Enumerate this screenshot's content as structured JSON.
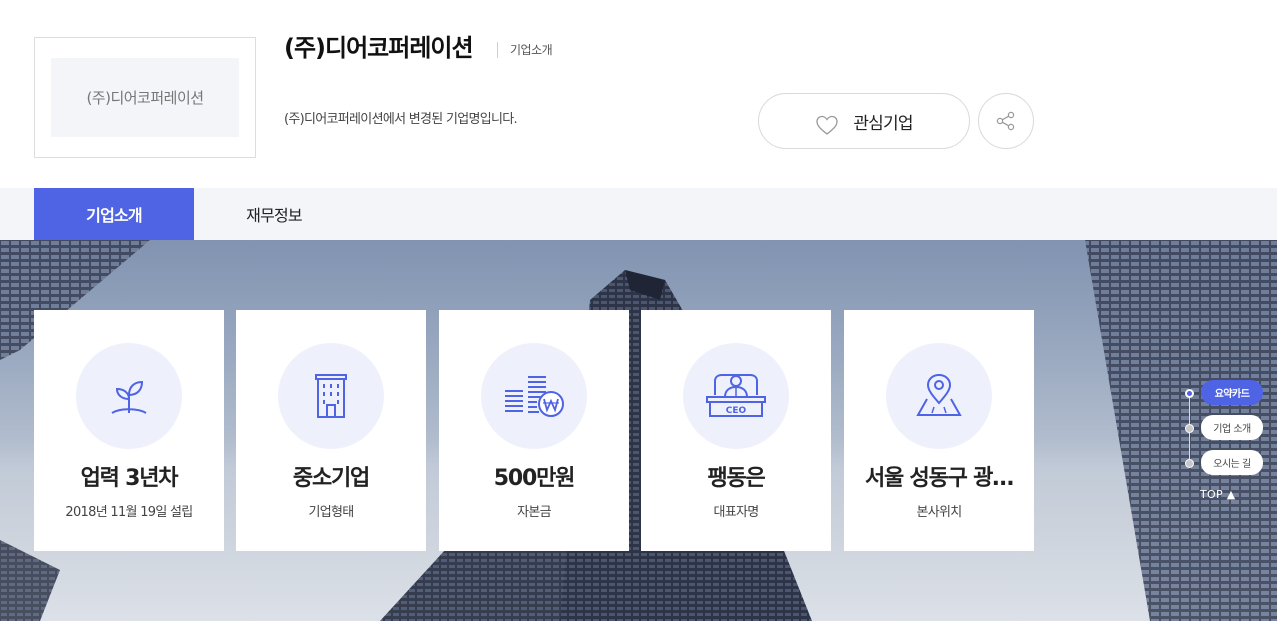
{
  "header": {
    "logo_text": "(주)디어코퍼레이션",
    "company_name": "(주)디어코퍼레이션",
    "subtitle": "기업소개",
    "description": "(주)디어코퍼레이션에서 변경된 기업명입니다.",
    "interest_label": "관심기업"
  },
  "tabs": [
    {
      "label": "기업소개",
      "active": true
    },
    {
      "label": "재무정보",
      "active": false
    }
  ],
  "cards": [
    {
      "icon": "sprout-icon",
      "value": "업력 3년차",
      "label": "2018년 11월 19일 설립"
    },
    {
      "icon": "building-icon",
      "value": "중소기업",
      "label": "기업형태"
    },
    {
      "icon": "money-won-icon",
      "value": "500만원",
      "label": "자본금"
    },
    {
      "icon": "ceo-icon",
      "value": "팽동은",
      "label": "대표자명"
    },
    {
      "icon": "location-pin-icon",
      "value": "서울 성동구 광…",
      "label": "본사위치"
    }
  ],
  "quick_nav": {
    "items": [
      {
        "label": "요약카드",
        "active": true
      },
      {
        "label": "기업 소개",
        "active": false
      },
      {
        "label": "오시는 길",
        "active": false
      }
    ],
    "top_label": "TOP"
  },
  "colors": {
    "accent": "#4f63e5",
    "icon_circle": "#eef1fb",
    "tab_bar": "#f4f5f9"
  }
}
